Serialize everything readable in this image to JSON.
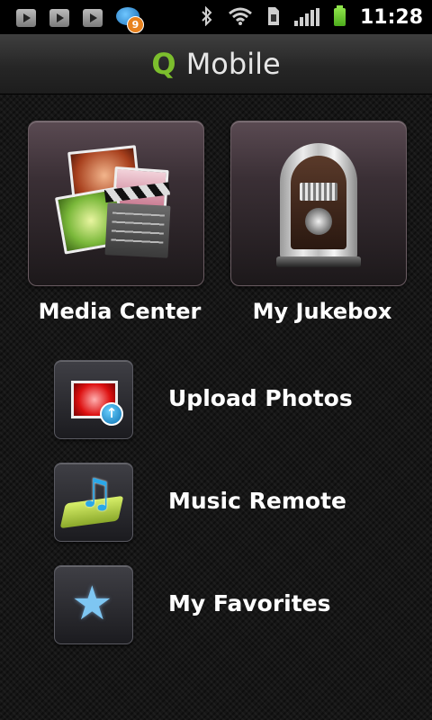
{
  "status_bar": {
    "notification_badge": "9",
    "time": "11:28",
    "icons": [
      "play-store-icon",
      "play-store-icon",
      "play-store-icon",
      "app-notification-icon",
      "bluetooth-icon",
      "wifi-icon",
      "sim-card-icon",
      "signal-icon",
      "battery-icon"
    ]
  },
  "title_bar": {
    "brand_q": "Q",
    "brand_rest": "Mobile"
  },
  "tiles": [
    {
      "label": "Media Center",
      "icon": "media-center-icon"
    },
    {
      "label": "My Jukebox",
      "icon": "jukebox-icon"
    }
  ],
  "list": [
    {
      "label": "Upload Photos",
      "icon": "upload-photos-icon"
    },
    {
      "label": "Music Remote",
      "icon": "music-remote-icon"
    },
    {
      "label": "My Favorites",
      "icon": "star-icon"
    }
  ],
  "colors": {
    "brand_green": "#7cbe2d",
    "background": "#161616",
    "text": "#ffffff"
  }
}
